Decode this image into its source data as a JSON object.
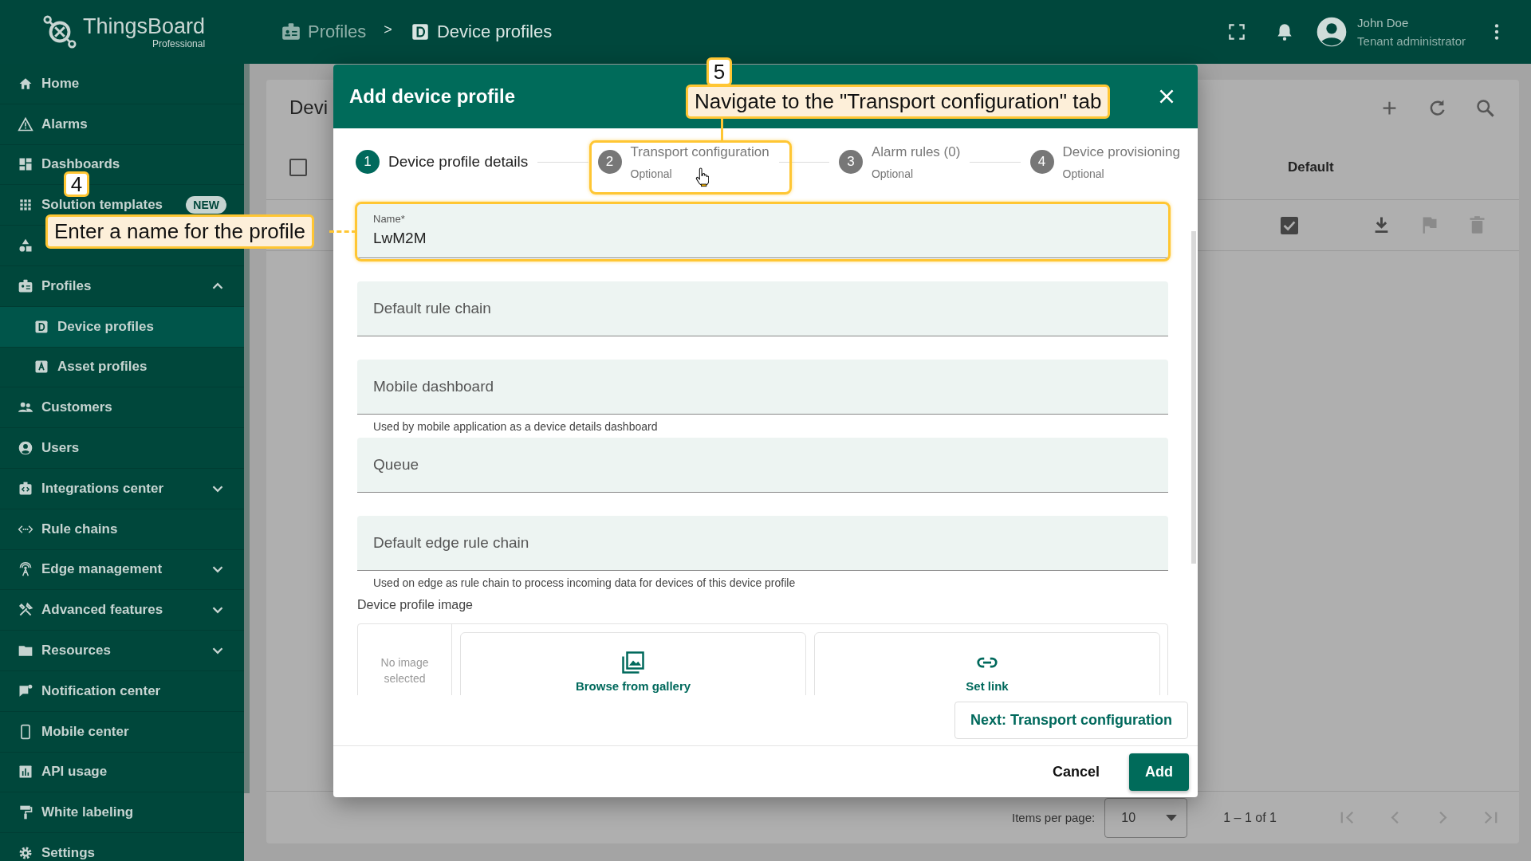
{
  "app": {
    "logo": "ThingsBoard",
    "edition": "Professional"
  },
  "breadcrumbs": [
    {
      "label": "Profiles",
      "selected": false
    },
    {
      "label": "Device profiles",
      "selected": true
    }
  ],
  "breadcrumb_separator": ">",
  "user": {
    "name": "John Doe",
    "role": "Tenant administrator"
  },
  "sidebar": {
    "items": [
      {
        "label": "Home",
        "selected": false
      },
      {
        "label": "Alarms",
        "selected": false
      },
      {
        "label": "Dashboards",
        "selected": false
      },
      {
        "label": "Solution templates",
        "selected": false,
        "badge": "NEW"
      },
      {
        "selected": false
      },
      {
        "label": "Profiles",
        "selected": false,
        "expanded": true,
        "children": [
          {
            "label": "Device profiles",
            "selected": true
          },
          {
            "label": "Asset profiles",
            "selected": false
          }
        ]
      },
      {
        "label": "Customers",
        "selected": false
      },
      {
        "label": "Users",
        "selected": false
      },
      {
        "label": "Integrations center",
        "selected": false,
        "expanded": false
      },
      {
        "label": "Rule chains",
        "selected": false
      },
      {
        "label": "Edge management",
        "selected": false,
        "expanded": false
      },
      {
        "label": "Advanced features",
        "selected": false,
        "expanded": false
      },
      {
        "label": "Resources",
        "selected": false,
        "expanded": false
      },
      {
        "label": "Notification center",
        "selected": false
      },
      {
        "label": "Mobile center",
        "selected": false
      },
      {
        "label": "API usage",
        "selected": false
      },
      {
        "label": "White labeling",
        "selected": false
      },
      {
        "label": "Settings",
        "selected": false
      }
    ]
  },
  "background_page": {
    "title": "Devi",
    "select_all": {
      "checked": false
    },
    "columns": [
      {
        "label": "Default"
      }
    ],
    "rows": [
      {
        "default": true
      }
    ],
    "pagination": {
      "items_per_page_label": "Items per page:",
      "page_size": "10",
      "range": "1 – 1 of 1"
    }
  },
  "dialog": {
    "title": "Add device profile",
    "steps": [
      {
        "number": "1",
        "label": "Device profile details",
        "selected": true
      },
      {
        "number": "2",
        "label": "Transport configuration",
        "sublabel": "Optional",
        "selected": false
      },
      {
        "number": "3",
        "label": "Alarm rules (0)",
        "sublabel": "Optional",
        "selected": false
      },
      {
        "number": "4",
        "label": "Device provisioning",
        "sublabel": "Optional",
        "selected": false
      }
    ],
    "fields": [
      {
        "label": "Name*",
        "value": "LwM2M"
      },
      {
        "placeholder": "Default rule chain"
      },
      {
        "placeholder": "Mobile dashboard",
        "hint": "Used by mobile application as a device details dashboard"
      },
      {
        "placeholder": "Queue"
      },
      {
        "placeholder": "Default edge rule chain",
        "hint": "Used on edge as rule chain to process incoming data for devices of this device profile"
      }
    ],
    "image": {
      "label": "Device profile image",
      "empty_text": "No image selected",
      "options": [
        "Browse from gallery",
        "Set link"
      ]
    },
    "next_button": "Next: Transport configuration",
    "buttons": [
      {
        "label": "Cancel",
        "kind": "text"
      },
      {
        "label": "Add",
        "kind": "primary"
      }
    ]
  },
  "annotations": [
    {
      "number": "4",
      "text": "Enter a name for the profile"
    },
    {
      "number": "5",
      "text": "Navigate to the \"Transport configuration\" tab"
    }
  ]
}
